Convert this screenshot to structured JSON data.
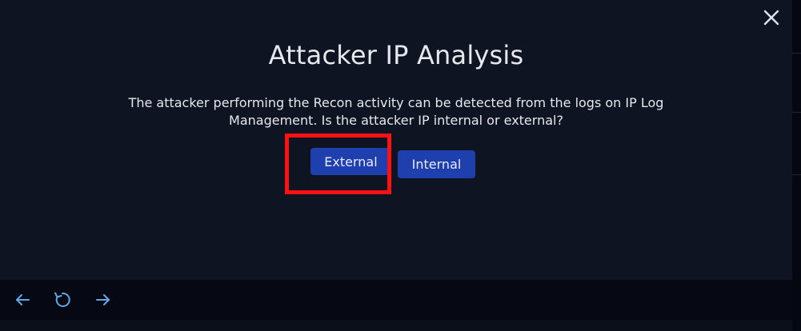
{
  "dialog": {
    "title": "Attacker IP Analysis",
    "description": "The attacker performing the Recon activity can be detected from the logs on IP Log Management. Is the attacker IP internal or external?",
    "options": [
      {
        "label": "External",
        "highlighted": true
      },
      {
        "label": "Internal",
        "highlighted": false
      }
    ],
    "close_icon": "close-icon"
  },
  "footer": {
    "icons": [
      "arrow-left-icon",
      "refresh-icon",
      "arrow-right-icon"
    ]
  },
  "colors": {
    "background": "#0f1422",
    "button": "#1f3fae",
    "highlight": "#ff1111",
    "footer_icon": "#5fa8e8"
  }
}
